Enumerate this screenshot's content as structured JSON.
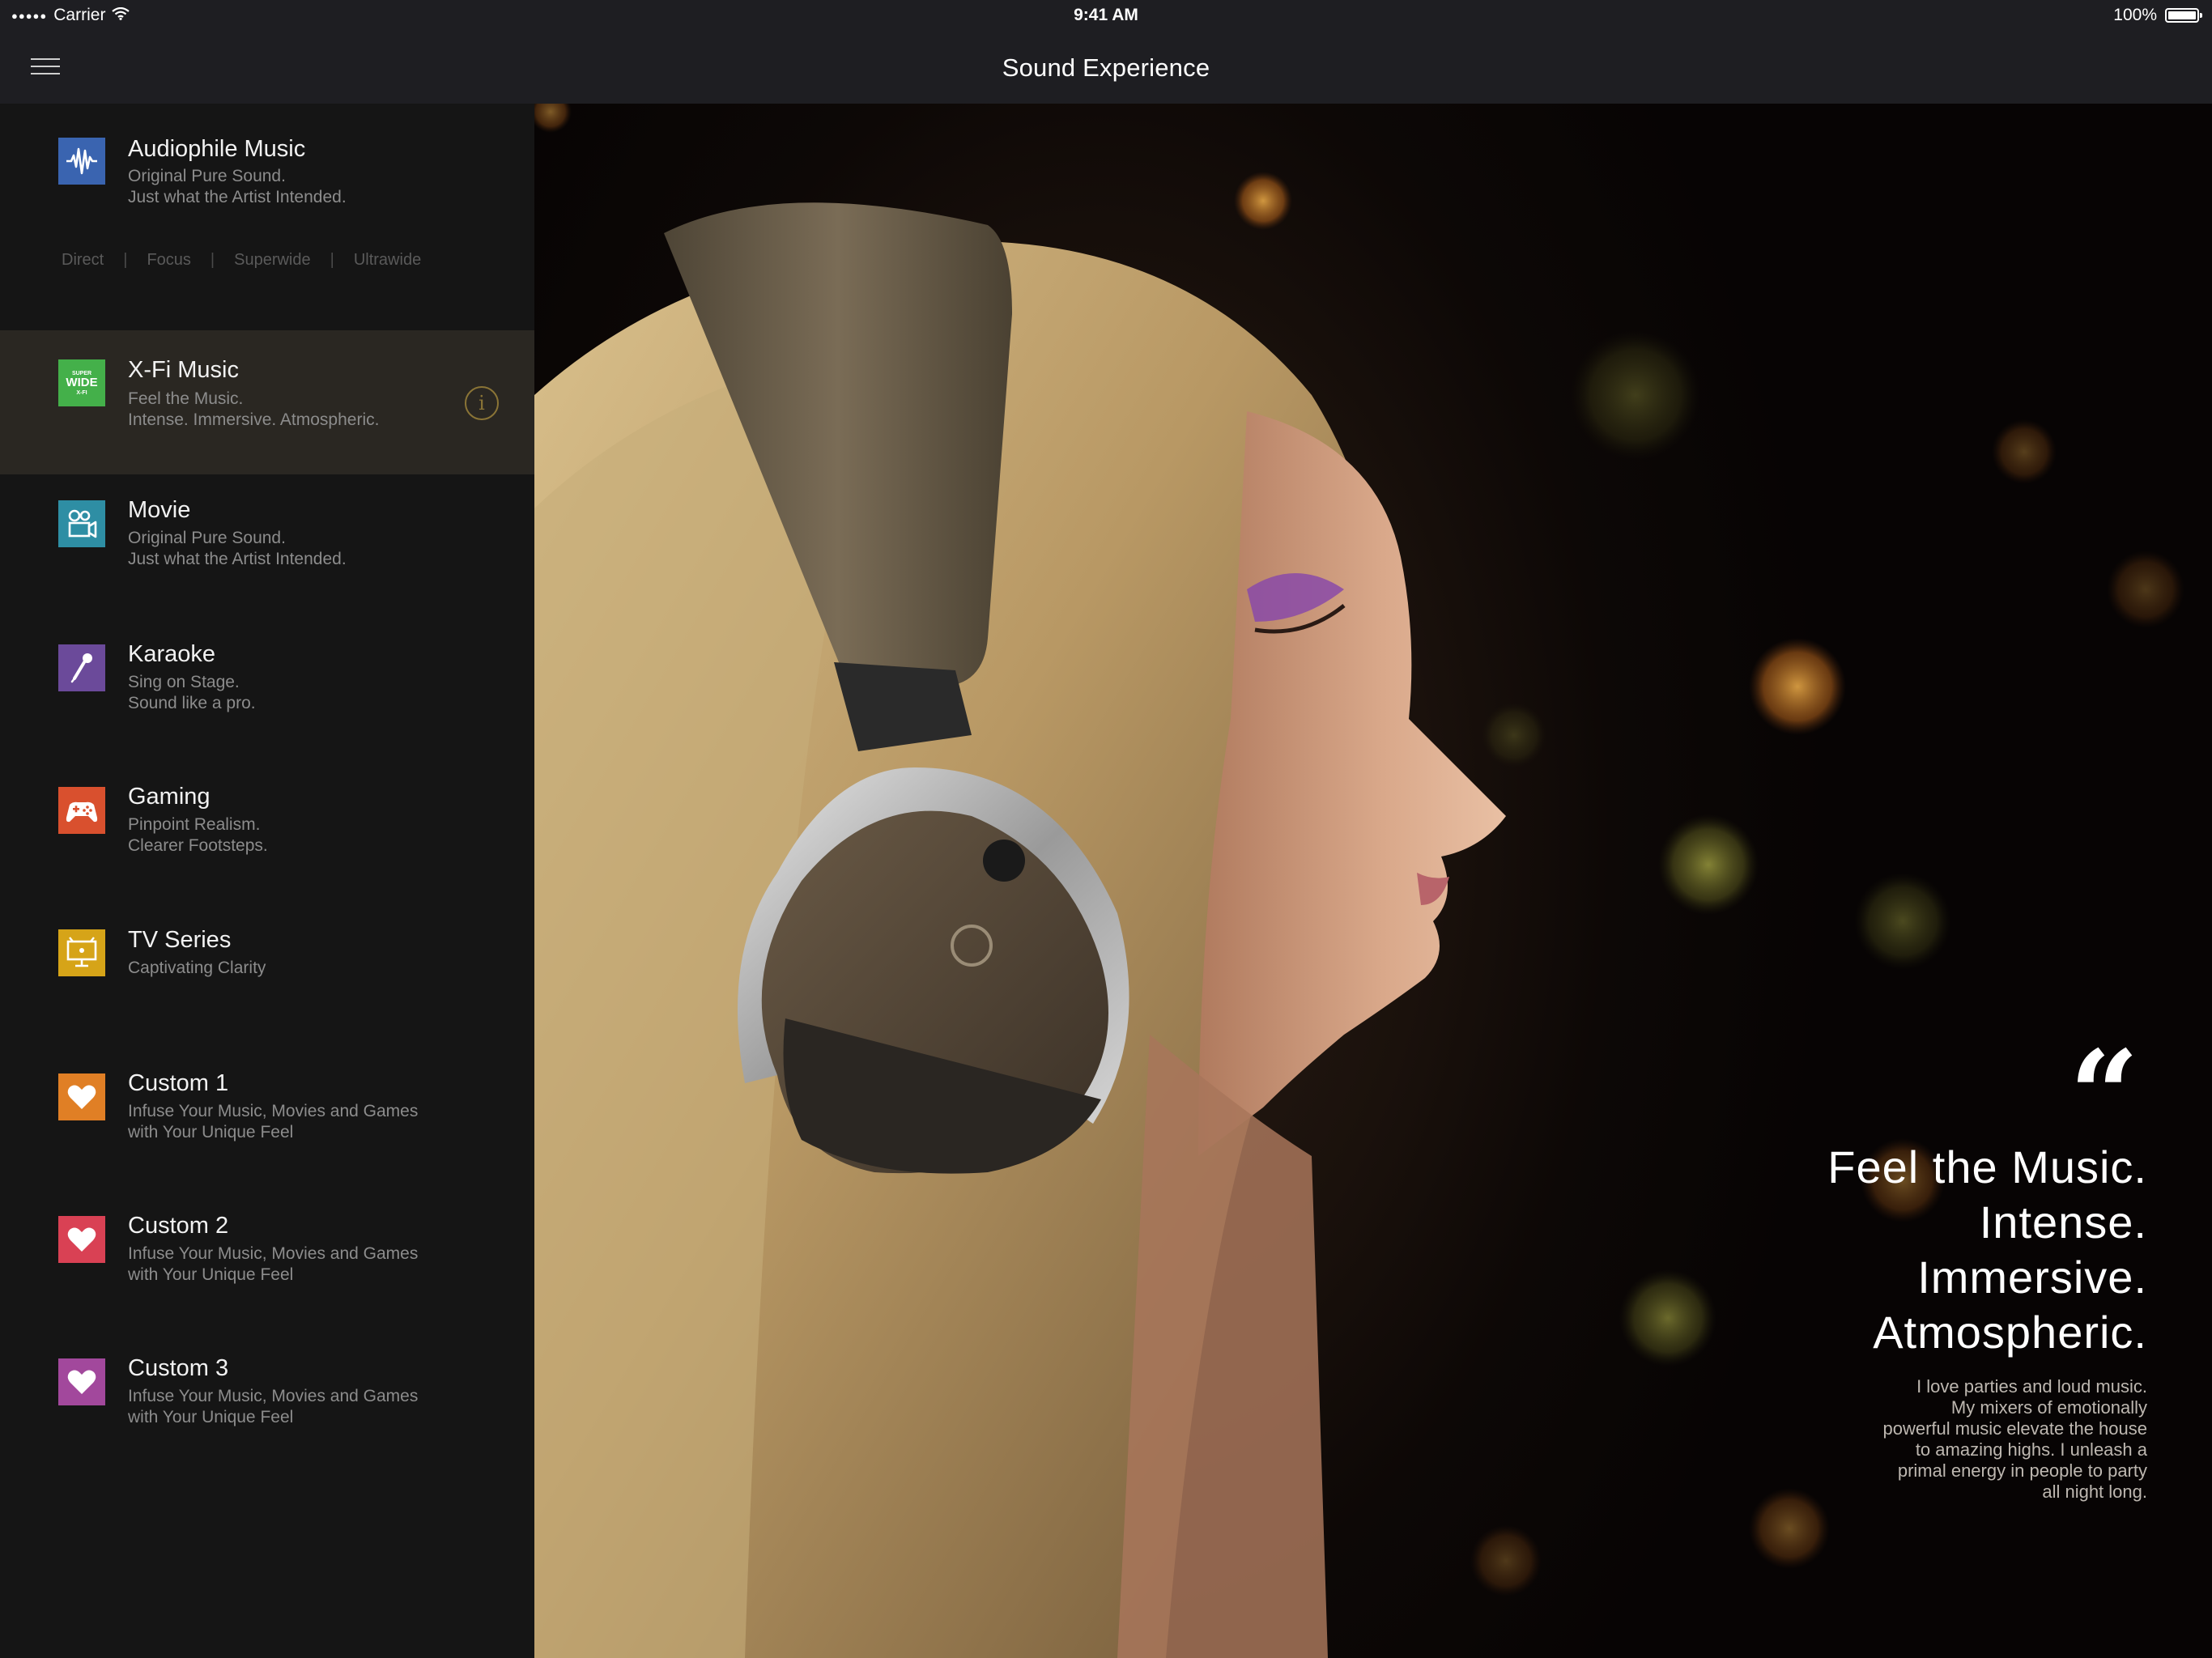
{
  "status_bar": {
    "carrier": "Carrier",
    "time": "9:41 AM",
    "battery": "100%"
  },
  "nav": {
    "title": "Sound Experience"
  },
  "modes": [
    {
      "title": "Audiophile Music",
      "desc": [
        "Original Pure Sound.",
        "Just what the Artist Intended."
      ],
      "icon": "waveform-icon",
      "color": "#3a64b0",
      "submodes": [
        "Direct",
        "Focus",
        "Superwide",
        "Ultrawide"
      ]
    },
    {
      "title": "X-Fi Music",
      "desc": [
        "Feel the Music.",
        "Intense. Immersive. Atmospheric."
      ],
      "icon": "super-wide-xfi-icon",
      "color": "#44b04a",
      "icon_text": [
        "SUPER",
        "WIDE",
        "X-FI"
      ],
      "selected": true
    },
    {
      "title": "Movie",
      "desc": [
        "Original Pure Sound.",
        "Just what the Artist Intended."
      ],
      "icon": "movie-camera-icon",
      "color": "#2e8ea4"
    },
    {
      "title": "Karaoke",
      "desc": [
        "Sing on Stage.",
        "Sound like a pro."
      ],
      "icon": "microphone-icon",
      "color": "#6b4a9a"
    },
    {
      "title": "Gaming",
      "desc": [
        "Pinpoint Realism.",
        "Clearer Footsteps."
      ],
      "icon": "gamepad-icon",
      "color": "#d9502e"
    },
    {
      "title": "TV Series",
      "desc": [
        "Captivating Clarity"
      ],
      "icon": "tv-icon",
      "color": "#d6a418"
    },
    {
      "title": "Custom 1",
      "desc": [
        "Infuse Your Music, Movies and Games",
        "with Your Unique Feel"
      ],
      "icon": "heart-icon",
      "color": "#e07f25"
    },
    {
      "title": "Custom 2",
      "desc": [
        "Infuse Your Music, Movies and Games",
        "with Your Unique Feel"
      ],
      "icon": "heart-icon",
      "color": "#d94154"
    },
    {
      "title": "Custom 3",
      "desc": [
        "Infuse Your Music, Movies and Games",
        "with Your Unique Feel"
      ],
      "icon": "heart-icon",
      "color": "#a2489c"
    }
  ],
  "hero": {
    "quote_mark": "“",
    "headline": [
      "Feel the Music.",
      "Intense.",
      "Immersive.",
      "Atmospheric."
    ],
    "body": [
      "I love parties and loud music.",
      "My mixers of emotionally",
      "powerful music elevate the house",
      "to amazing highs. I unleash a",
      "primal energy in people to party",
      "all night long."
    ]
  }
}
